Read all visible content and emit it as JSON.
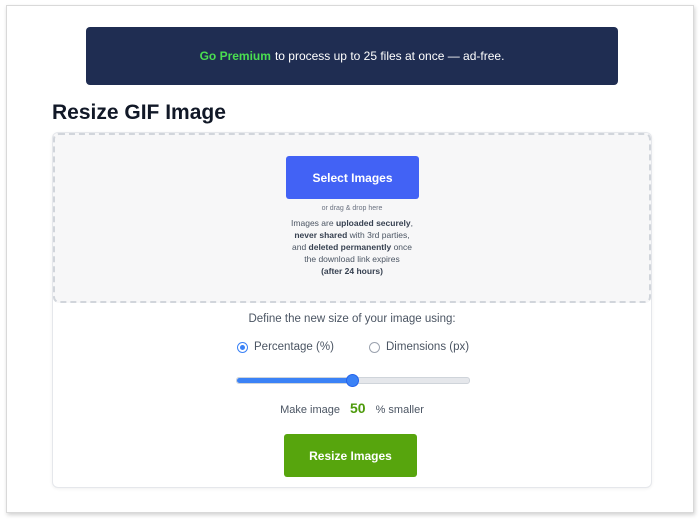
{
  "banner": {
    "premium_link": "Go Premium",
    "text": "to process up to 25 files at once — ad-free."
  },
  "page": {
    "title": "Resize GIF Image"
  },
  "upload": {
    "select_button": "Select Images",
    "drag_hint": "or drag & drop here",
    "note": {
      "p1": "Images are ",
      "b1": "uploaded securely",
      "p2": ",",
      "b2": "never shared",
      "p3": " with 3rd parties,",
      "p4": "and ",
      "b3": "deleted permanently",
      "p5": " once",
      "p6": "the download link expires",
      "b4": "(after 24 hours)"
    }
  },
  "resize": {
    "define_label": "Define the new size of your image using:",
    "options": [
      {
        "label": "Percentage (%)",
        "checked": true
      },
      {
        "label": "Dimensions (px)",
        "checked": false
      }
    ],
    "slider_percent": 50,
    "make_prefix": "Make image",
    "percent_value": "50",
    "make_suffix": "% smaller",
    "submit_button": "Resize Images"
  },
  "colors": {
    "banner_bg": "#1f2d52",
    "premium": "#4ade50",
    "select_button": "#4262f5",
    "accent": "#3b82f6",
    "resize_button": "#57a50d",
    "percent_value": "#4d9a0b"
  }
}
